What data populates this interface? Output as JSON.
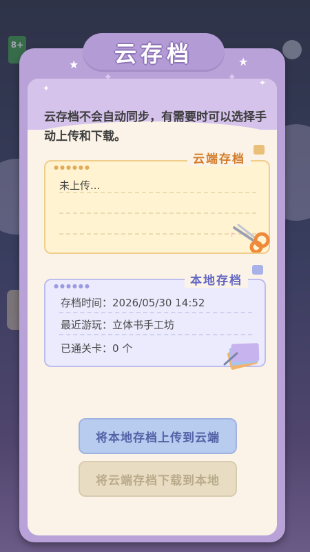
{
  "background": {
    "age_badge": "8+"
  },
  "dialog": {
    "title": "云存档",
    "description": "云存档不会自动同步，有需要时可以选择手动上传和下载。",
    "cloud_save": {
      "tag": "云端存档",
      "status": "未上传..."
    },
    "local_save": {
      "tag": "本地存档",
      "time_label": "存档时间：",
      "time_value": "2026/05/30 14:52",
      "recent_label": "最近游玩：",
      "recent_value": "立体书手工坊",
      "cleared_label": "已通关卡：",
      "cleared_value": "0 个"
    },
    "buttons": {
      "upload": "将本地存档上传到云端",
      "download": "将云端存档下载到本地"
    }
  },
  "colors": {
    "panel_border": "#b9a2d8",
    "panel_fill": "#fbf3e7",
    "cloud_accent": "#d47c2b",
    "local_accent": "#6266c4",
    "upload_button": "#b8ccef",
    "download_button_disabled": "#e8dcc2"
  },
  "icons": [
    "scissors-icon",
    "paper-stack-icon",
    "clip-icon",
    "star-icon"
  ]
}
